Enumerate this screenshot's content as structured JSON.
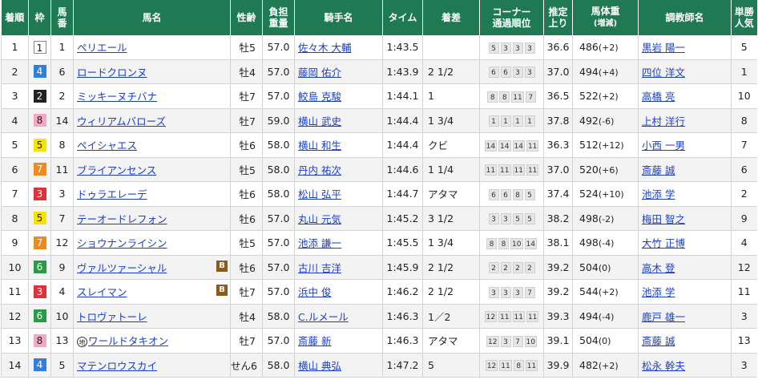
{
  "headers": {
    "rank": "着順",
    "waku": "枠",
    "umaban": [
      "馬",
      "番"
    ],
    "horse": "馬名",
    "sexage": "性齢",
    "burden": [
      "負担",
      "重量"
    ],
    "jockey": "騎手名",
    "time": "タイム",
    "margin": "着差",
    "corner": [
      "コーナー",
      "通過順位"
    ],
    "last3f": [
      "推定",
      "上り"
    ],
    "weight": [
      "馬体重",
      "(増減)"
    ],
    "trainer": "調教師名",
    "pop": [
      "単勝",
      "人気"
    ]
  },
  "rows": [
    {
      "rank": "1",
      "waku": "1",
      "umaban": "1",
      "horse": "ペリエール",
      "local": false,
      "blinker": false,
      "sexage": "牡5",
      "burden": "57.0",
      "jockey": "佐々木 大輔",
      "time": "1:43.5",
      "margin": "",
      "corner": [
        "5",
        "3",
        "3",
        "3"
      ],
      "last3f": "36.6",
      "weight": "486",
      "diff": "(+2)",
      "trainer": "黒岩 陽一",
      "pop": "5"
    },
    {
      "rank": "2",
      "waku": "4",
      "umaban": "6",
      "horse": "ロードクロンヌ",
      "local": false,
      "blinker": false,
      "sexage": "牡4",
      "burden": "57.0",
      "jockey": "藤岡 佑介",
      "time": "1:43.9",
      "margin": "2 1/2",
      "corner": [
        "6",
        "6",
        "3",
        "3"
      ],
      "last3f": "37.0",
      "weight": "494",
      "diff": "(+4)",
      "trainer": "四位 洋文",
      "pop": "1"
    },
    {
      "rank": "3",
      "waku": "2",
      "umaban": "2",
      "horse": "ミッキーヌチバナ",
      "local": false,
      "blinker": false,
      "sexage": "牡7",
      "burden": "57.0",
      "jockey": "鮫島 克駿",
      "time": "1:44.1",
      "margin": "1",
      "corner": [
        "8",
        "8",
        "11",
        "7"
      ],
      "last3f": "36.5",
      "weight": "522",
      "diff": "(+2)",
      "trainer": "高橋 亮",
      "pop": "10"
    },
    {
      "rank": "4",
      "waku": "8",
      "umaban": "14",
      "horse": "ウィリアムバローズ",
      "local": false,
      "blinker": false,
      "sexage": "牡7",
      "burden": "59.0",
      "jockey": "横山 武史",
      "time": "1:44.4",
      "margin": "1 3/4",
      "corner": [
        "1",
        "1",
        "1",
        "1"
      ],
      "last3f": "37.8",
      "weight": "492",
      "diff": "(-6)",
      "trainer": "上村 洋行",
      "pop": "8"
    },
    {
      "rank": "5",
      "waku": "5",
      "umaban": "8",
      "horse": "ペイシャエス",
      "local": false,
      "blinker": false,
      "sexage": "牡6",
      "burden": "58.0",
      "jockey": "横山 和生",
      "time": "1:44.4",
      "margin": "クビ",
      "corner": [
        "14",
        "14",
        "14",
        "11"
      ],
      "last3f": "36.3",
      "weight": "512",
      "diff": "(+12)",
      "trainer": "小西 一男",
      "pop": "7"
    },
    {
      "rank": "6",
      "waku": "7",
      "umaban": "11",
      "horse": "ブライアンセンス",
      "local": false,
      "blinker": false,
      "sexage": "牡5",
      "burden": "58.0",
      "jockey": "丹内 祐次",
      "time": "1:44.6",
      "margin": "1 1/4",
      "corner": [
        "11",
        "11",
        "11",
        "11"
      ],
      "last3f": "37.0",
      "weight": "520",
      "diff": "(+6)",
      "trainer": "斎藤 誠",
      "pop": "6"
    },
    {
      "rank": "7",
      "waku": "3",
      "umaban": "3",
      "horse": "ドゥラエレーデ",
      "local": false,
      "blinker": false,
      "sexage": "牡6",
      "burden": "58.0",
      "jockey": "松山 弘平",
      "time": "1:44.7",
      "margin": "アタマ",
      "corner": [
        "6",
        "6",
        "8",
        "5"
      ],
      "last3f": "37.4",
      "weight": "524",
      "diff": "(+10)",
      "trainer": "池添 学",
      "pop": "2"
    },
    {
      "rank": "8",
      "waku": "5",
      "umaban": "7",
      "horse": "テーオードレフォン",
      "local": false,
      "blinker": false,
      "sexage": "牡6",
      "burden": "57.0",
      "jockey": "丸山 元気",
      "time": "1:45.2",
      "margin": "3 1/2",
      "corner": [
        "3",
        "3",
        "5",
        "5"
      ],
      "last3f": "38.2",
      "weight": "498",
      "diff": "(-2)",
      "trainer": "梅田 智之",
      "pop": "9"
    },
    {
      "rank": "9",
      "waku": "7",
      "umaban": "12",
      "horse": "ショウナンライシン",
      "local": false,
      "blinker": false,
      "sexage": "牡5",
      "burden": "57.0",
      "jockey": "池添 謙一",
      "time": "1:45.5",
      "margin": "1 3/4",
      "corner": [
        "8",
        "8",
        "10",
        "14"
      ],
      "last3f": "38.1",
      "weight": "498",
      "diff": "(-4)",
      "trainer": "大竹 正博",
      "pop": "4"
    },
    {
      "rank": "10",
      "waku": "6",
      "umaban": "9",
      "horse": "ヴァルツァーシャル",
      "local": false,
      "blinker": true,
      "sexage": "牡6",
      "burden": "57.0",
      "jockey": "古川 吉洋",
      "time": "1:45.9",
      "margin": "2 1/2",
      "corner": [
        "2",
        "2",
        "2",
        "2"
      ],
      "last3f": "39.2",
      "weight": "504",
      "diff": "(0)",
      "trainer": "高木 登",
      "pop": "12"
    },
    {
      "rank": "11",
      "waku": "3",
      "umaban": "4",
      "horse": "スレイマン",
      "local": false,
      "blinker": true,
      "sexage": "牡7",
      "burden": "57.0",
      "jockey": "浜中 俊",
      "time": "1:46.2",
      "margin": "2 1/2",
      "corner": [
        "3",
        "3",
        "3",
        "7"
      ],
      "last3f": "39.2",
      "weight": "544",
      "diff": "(+2)",
      "trainer": "池添 学",
      "pop": "11"
    },
    {
      "rank": "12",
      "waku": "6",
      "umaban": "10",
      "horse": "トロヴァトーレ",
      "local": false,
      "blinker": false,
      "sexage": "牡4",
      "burden": "58.0",
      "jockey": "C.ルメール",
      "time": "1:46.3",
      "margin": "1／2",
      "corner": [
        "12",
        "11",
        "11",
        "11"
      ],
      "last3f": "39.3",
      "weight": "494",
      "diff": "(-4)",
      "trainer": "鹿戸 雄一",
      "pop": "3"
    },
    {
      "rank": "13",
      "waku": "8",
      "umaban": "13",
      "horse": "ワールドタキオン",
      "local": true,
      "localMark": "地",
      "blinker": false,
      "sexage": "牡7",
      "burden": "57.0",
      "jockey": "斎藤 新",
      "time": "1:46.3",
      "margin": "アタマ",
      "corner": [
        "12",
        "3",
        "7",
        "10"
      ],
      "last3f": "39.1",
      "weight": "504",
      "diff": "(0)",
      "trainer": "斎藤 誠",
      "pop": "13"
    },
    {
      "rank": "14",
      "waku": "4",
      "umaban": "5",
      "horse": "マテンロウスカイ",
      "local": false,
      "blinker": false,
      "sexage": "せん6",
      "burden": "58.0",
      "jockey": "横山 典弘",
      "time": "1:47.2",
      "margin": "5",
      "corner": [
        "12",
        "11",
        "8",
        "11"
      ],
      "last3f": "39.9",
      "weight": "482",
      "diff": "(+2)",
      "trainer": "松永 幹夫",
      "pop": "3"
    }
  ],
  "blinker_mark": "B"
}
